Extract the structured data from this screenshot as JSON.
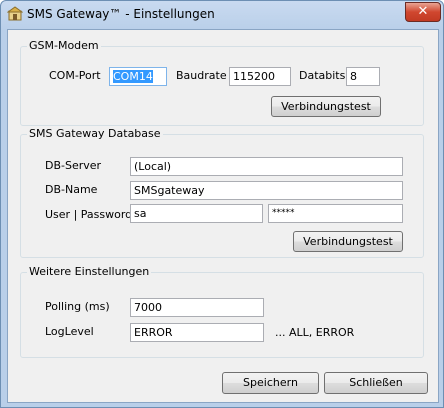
{
  "window": {
    "title": "SMS Gateway™ - Einstellungen",
    "close_label": "✕"
  },
  "gsm": {
    "legend": "GSM-Modem",
    "comport_label": "COM-Port",
    "comport_value": "COM14",
    "baudrate_label": "Baudrate",
    "baudrate_value": "115200",
    "databits_label": "Databits",
    "databits_value": "8",
    "test_button": "Verbindungstest"
  },
  "db": {
    "legend": "SMS Gateway Database",
    "server_label": "DB-Server",
    "server_value": "(Local)",
    "name_label": "DB-Name",
    "name_value": "SMSgateway",
    "user_label": "User | Password",
    "user_value": "sa",
    "password_value": "*****",
    "test_button": "Verbindungstest"
  },
  "other": {
    "legend": "Weitere Einstellungen",
    "polling_label": "Polling (ms)",
    "polling_value": "7000",
    "loglevel_label": "LogLevel",
    "loglevel_value": "ERROR",
    "loglevel_hint": "... ALL, ERROR"
  },
  "footer": {
    "save_button": "Speichern",
    "close_button": "Schließen"
  }
}
